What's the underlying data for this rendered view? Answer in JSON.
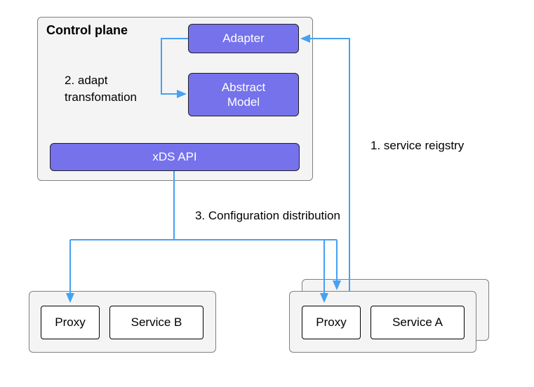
{
  "controlPlane": {
    "title": "Control plane",
    "noteLine1": "2. adapt",
    "noteLine2": "transfomation",
    "adapter": "Adapter",
    "abstractLine1": "Abstract",
    "abstractLine2": "Model",
    "xds": "xDS API"
  },
  "labels": {
    "registry": "1. service reigstry",
    "config": "3. Configuration distribution"
  },
  "podB": {
    "proxy": "Proxy",
    "service": "Service B"
  },
  "podA": {
    "proxy": "Proxy",
    "service": "Service A"
  },
  "colors": {
    "accent": "#7572ec",
    "arrow": "#45a1f2",
    "boxBg": "#f4f4f4"
  }
}
